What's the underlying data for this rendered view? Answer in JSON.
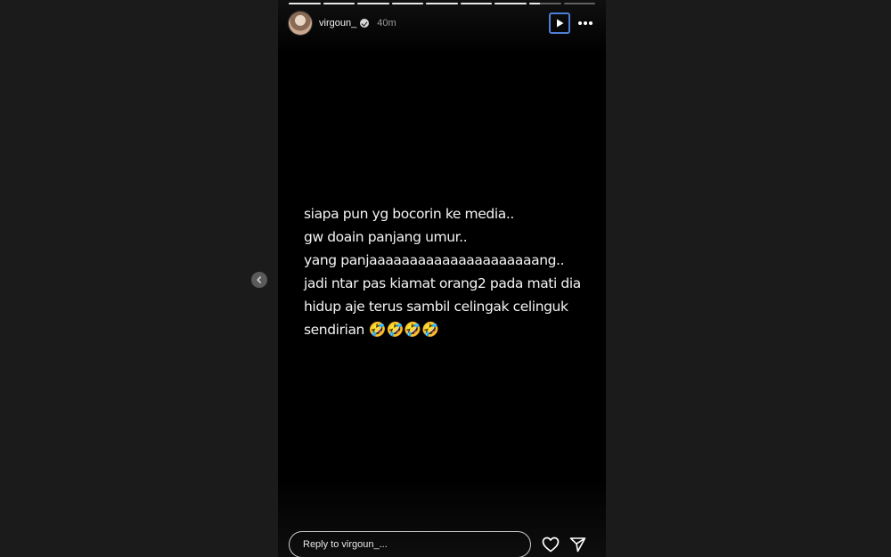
{
  "story": {
    "username": "virgoun_",
    "time": "40m",
    "segments": [
      1,
      1,
      1,
      1,
      1,
      1,
      1,
      0.35,
      0
    ],
    "caption_lines": [
      "siapa pun yg bocorin ke media..",
      "gw doain panjang umur..",
      "yang panjaaaaaaaaaaaaaaaaaaaaang..",
      "jadi ntar pas kiamat orang2 pada mati dia",
      "hidup aje terus sambil celingak celinguk",
      "sendirian"
    ],
    "caption_emoji": "🤣🤣🤣🤣",
    "reply_placeholder": "Reply to virgoun_...",
    "icons": {
      "avatar": "user-avatar",
      "verified": "verified-badge-icon",
      "play": "play-icon",
      "more": "more-options-icon",
      "prev": "chevron-left-icon",
      "like": "heart-icon",
      "share": "send-icon"
    },
    "colors": {
      "focus_ring": "#4d7fd6",
      "background": "#000000"
    }
  }
}
